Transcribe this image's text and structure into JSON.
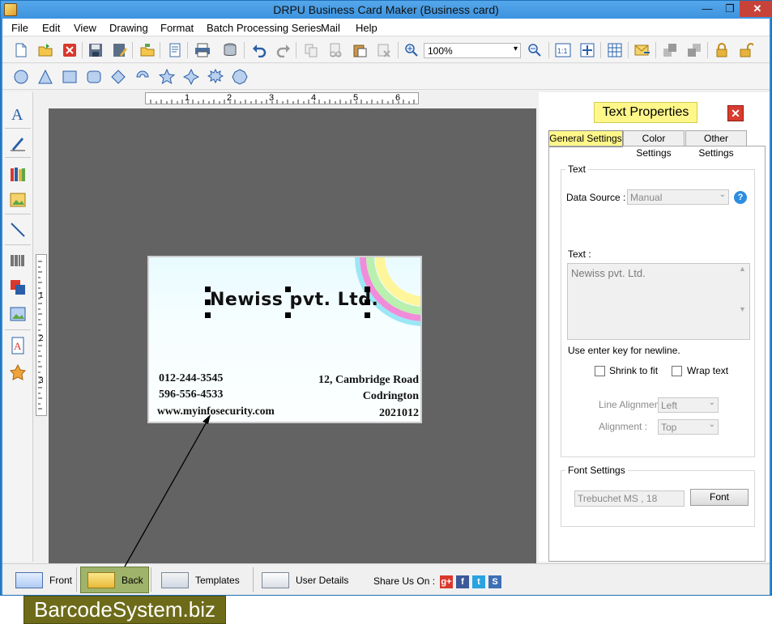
{
  "window": {
    "title": "DRPU Business Card Maker (Business card)",
    "minimize": "—",
    "restore": "❐",
    "close": "✕"
  },
  "menu": {
    "file": "File",
    "edit": "Edit",
    "view": "View",
    "drawing": "Drawing",
    "format": "Format",
    "batch": "Batch Processing Series",
    "mail": "Mail",
    "help": "Help"
  },
  "toolbar": {
    "zoom": "100%"
  },
  "card": {
    "title": "Newiss pvt. Ltd.",
    "phone1": "012-244-3545",
    "phone2": "596-556-4533",
    "website": "www.myinfosecurity.com",
    "address1": "12, Cambridge Road",
    "address2": "Codrington",
    "zip": "2021012"
  },
  "ruler": {
    "top_ticks": [
      "1",
      "2",
      "3",
      "4",
      "5",
      "6"
    ],
    "left_ticks": [
      "1",
      "2",
      "3"
    ]
  },
  "properties": {
    "title": "Text Properties",
    "close": "✕",
    "tabs": {
      "general": "General Settings",
      "color": "Color Settings",
      "other": "Other Settings"
    },
    "text_group": "Text",
    "data_source_label": "Data Source :",
    "data_source_value": "Manual",
    "text_label": "Text :",
    "text_value": "Newiss pvt. Ltd.",
    "hint": "Use enter key for newline.",
    "shrink": "Shrink to fit",
    "wrap": "Wrap text",
    "line_alignment_label": "Line Alignment",
    "line_alignment_value": "Left",
    "alignment_label": "Alignment :",
    "alignment_value": "Top",
    "font_group": "Font Settings",
    "font_value": "Trebuchet MS , 18",
    "font_button": "Font",
    "help": "?"
  },
  "bottom": {
    "front": "Front",
    "back": "Back",
    "templates": "Templates",
    "user_details": "User Details",
    "share": "Share Us On :",
    "g": "g+",
    "f": "f",
    "t": "t",
    "s": "S"
  },
  "colors": {
    "accent_yellow": "#fff78a",
    "title_bar": "#3d93df",
    "back_active": "#9fb36a",
    "canvas": "#636363"
  },
  "watermark": "BarcodeSystem.biz"
}
